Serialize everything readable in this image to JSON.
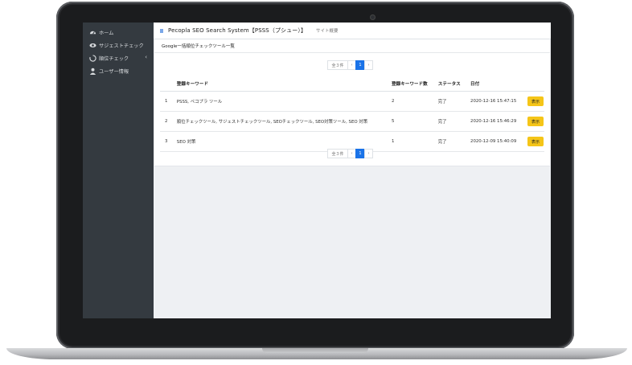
{
  "app": {
    "title": "Pecopla SEO Search System【PSSS（プシュー）】",
    "nav_link": "サイト概要"
  },
  "sidebar": {
    "items": [
      {
        "label": "ホーム",
        "icon": "dashboard-icon"
      },
      {
        "label": "サジェストチェック",
        "icon": "eye-icon"
      },
      {
        "label": "順位チェック",
        "icon": "spinner-icon",
        "chevron": "‹"
      },
      {
        "label": "ユーザー情報",
        "icon": "user-icon"
      }
    ]
  },
  "card": {
    "title": "Google一括順位チェックツール一覧"
  },
  "pagination": {
    "count_label": "全３件",
    "prev": "‹",
    "current": "1",
    "next": "›"
  },
  "table": {
    "headers": [
      "",
      "登録キーワード",
      "登録キーワード数",
      "ステータス",
      "日付",
      ""
    ],
    "rows": [
      {
        "no": "1",
        "keywords": "PSSS, ペコプラ ツール",
        "count": "2",
        "status": "完了",
        "date": "2020-12-16 15:47:15",
        "action": "表示"
      },
      {
        "no": "2",
        "keywords": "順位チェックツール, サジェストチェックツール, SEOチェックツール, SEO対策ツール, SEO 対策",
        "count": "5",
        "status": "完了",
        "date": "2020-12-16 15:46:29",
        "action": "表示"
      },
      {
        "no": "3",
        "keywords": "SEO 対策",
        "count": "1",
        "status": "完了",
        "date": "2020-12-09 15:40:09",
        "action": "表示"
      }
    ]
  },
  "colors": {
    "sidebar_bg": "#343a40",
    "accent": "#1a73e8",
    "button": "#f5c518"
  }
}
